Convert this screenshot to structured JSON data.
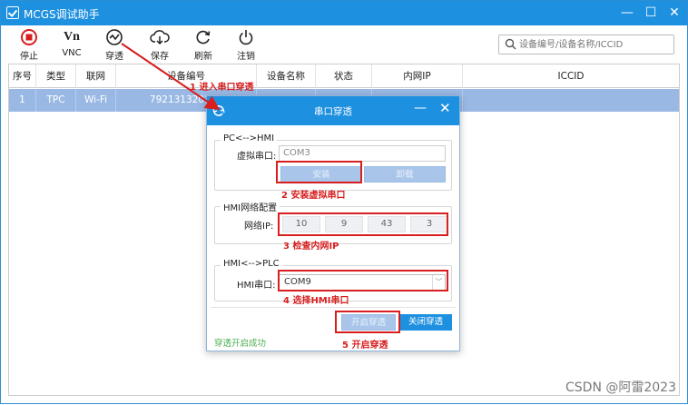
{
  "window": {
    "title": "MCGS调试助手",
    "min": "—",
    "max": "☐",
    "close": "✕"
  },
  "toolbar": {
    "stop": "停止",
    "vnc": "VNC",
    "passthrough": "穿透",
    "save": "保存",
    "refresh": "刷新",
    "logout": "注销",
    "vnc_glyph": "Vn",
    "search_placeholder": "设备编号/设备名称/ICCID"
  },
  "table": {
    "headers": [
      "序号",
      "类型",
      "联网",
      "设备编号",
      "设备名称",
      "状态",
      "内网IP",
      "ICCID"
    ],
    "rows": [
      {
        "index": "1",
        "type": "TPC",
        "network": "Wi-Fi",
        "device_id": "792131320121",
        "device_name": "",
        "status": "",
        "ip": "",
        "iccid": ""
      }
    ]
  },
  "dialog": {
    "title": "串口穿透",
    "min": "—",
    "close": "✕",
    "group1": {
      "title": "PC<-->HMI",
      "label": "虚拟串口:",
      "value": "COM3",
      "install": "安装",
      "uninstall": "卸载"
    },
    "group2": {
      "title": "HMI网络配置",
      "label": "网络IP:",
      "ip": [
        "10",
        "9",
        "43",
        "3"
      ]
    },
    "group3": {
      "title": "HMI<-->PLC",
      "label": "HMI串口:",
      "value": "COM9"
    },
    "start": "开启穿透",
    "stop": "关闭穿透",
    "status": "穿透开启成功"
  },
  "annotations": {
    "a1": "1 进入串口穿透",
    "a2": "2 安装虚拟串口",
    "a3": "3 检查内网IP",
    "a4": "4 选择HMI串口",
    "a5": "5 开启穿透"
  },
  "watermark": "CSDN @阿雷2023",
  "colors": {
    "accent": "#1e90e0",
    "highlight": "#d81e1e",
    "selected_row": "#99b9e4",
    "success": "#4caf50"
  }
}
